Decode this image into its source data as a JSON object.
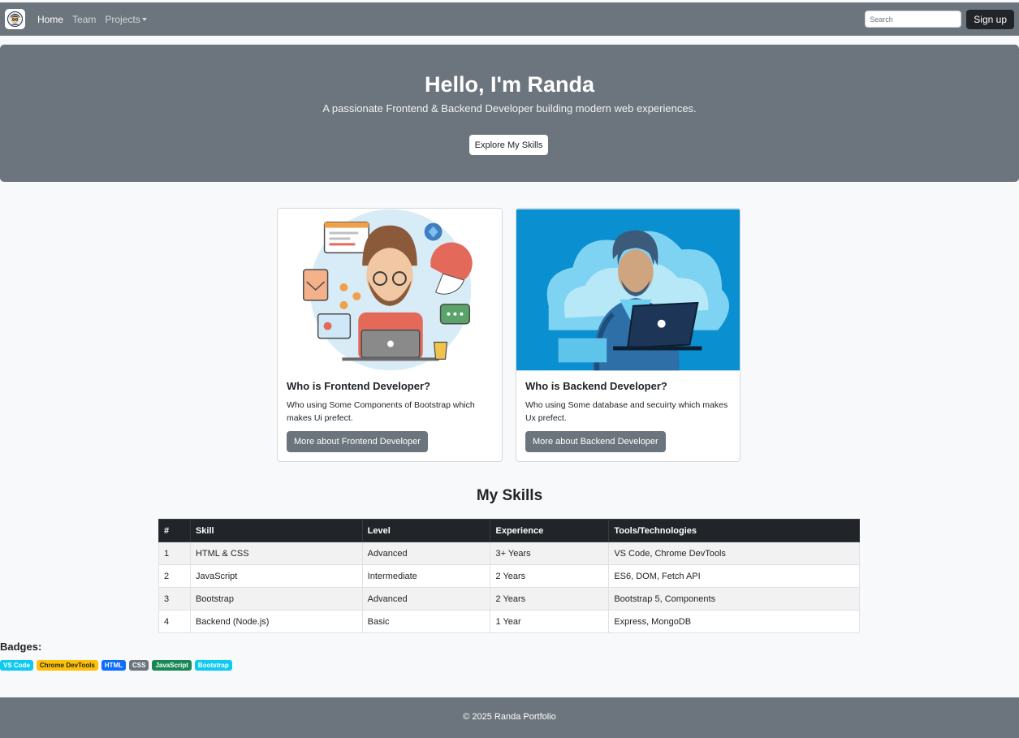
{
  "navbar": {
    "logo_icon": "developer-avatar-logo",
    "links": [
      {
        "label": "Home",
        "active": true
      },
      {
        "label": "Team",
        "active": false
      },
      {
        "label": "Projects",
        "active": false,
        "dropdown": true
      }
    ],
    "search_placeholder": "Search",
    "signup_label": "Sign up"
  },
  "hero": {
    "title": "Hello, I'm Randa",
    "subtitle": "A passionate Frontend & Backend Developer building modern web experiences.",
    "button_label": "Explore My Skills"
  },
  "cards": [
    {
      "image_icon": "frontend-developer-illustration",
      "title": "Who is Frontend Developer?",
      "text": "Who using Some Components of Bootstrap which makes Ui prefect.",
      "button_label": "More about Frontend Developer"
    },
    {
      "image_icon": "backend-developer-illustration",
      "title": "Who is Backend Developer?",
      "text": "Who using Some database and secuirty which makes Ux prefect.",
      "button_label": "More about Backend Developer"
    }
  ],
  "skills": {
    "title": "My Skills",
    "headers": [
      "#",
      "Skill",
      "Level",
      "Experience",
      "Tools/Technologies"
    ],
    "rows": [
      [
        "1",
        "HTML & CSS",
        "Advanced",
        "3+ Years",
        "VS Code, Chrome DevTools"
      ],
      [
        "2",
        "JavaScript",
        "Intermediate",
        "2 Years",
        "ES6, DOM, Fetch API"
      ],
      [
        "3",
        "Bootstrap",
        "Advanced",
        "2 Years",
        "Bootstrap 5, Components"
      ],
      [
        "4",
        "Backend (Node.js)",
        "Basic",
        "1 Year",
        "Express, MongoDB"
      ]
    ]
  },
  "badges": {
    "label": "Badges:",
    "items": [
      {
        "text": "VS Code",
        "color": "#0dcaf0"
      },
      {
        "text": "Chrome DevTools",
        "color": "#ffc107"
      },
      {
        "text": "HTML",
        "color": "#0d6efd"
      },
      {
        "text": "CSS",
        "color": "#6c757d"
      },
      {
        "text": "JavaScript",
        "color": "#198754"
      },
      {
        "text": "Bootstrap",
        "color": "#0dcaf0"
      }
    ]
  },
  "footer": {
    "text": "© 2025 Randa Portfolio"
  },
  "colors": {
    "navbar_bg": "#6c757d",
    "dark": "#212529",
    "page_bg": "#f8f9fa"
  }
}
